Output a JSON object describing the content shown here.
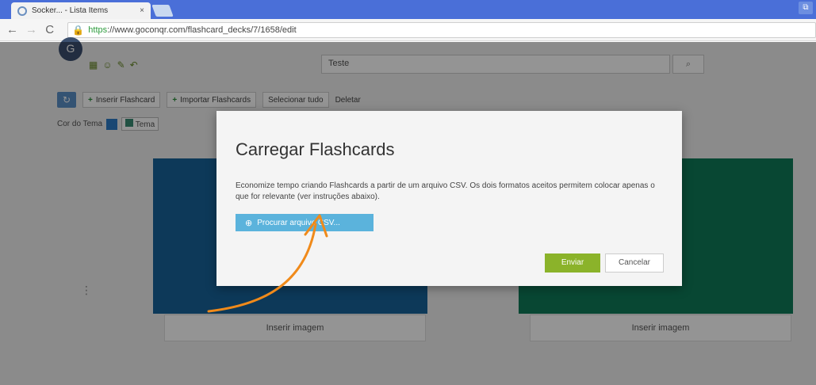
{
  "browser": {
    "tab_title": "Socker... - Lista Items",
    "tab_close": "×",
    "win_button": "⧉",
    "nav": {
      "back": "←",
      "forward": "→",
      "reload": "C"
    },
    "url_scheme": "https",
    "url_rest": "://www.goconqr.com/flashcard_decks/7/1658/edit"
  },
  "app": {
    "logo": "G",
    "toolbar_icons": [
      "▦",
      "☺",
      "✎",
      "↶"
    ],
    "deck_title": "Teste",
    "search_icon": "⌕",
    "actions": {
      "refresh": "↻",
      "insert_flashcard": "Inserir Flashcard",
      "import_flashcards": "Importar Flashcards",
      "select_all": "Selecionar tudo",
      "delete": "Deletar"
    },
    "theme": {
      "label": "Cor do Tema",
      "select_label": "Tema"
    },
    "card_footer_left": "Inserir imagem",
    "card_footer_right": "Inserir imagem",
    "side_handle": "⋮"
  },
  "modal": {
    "title": "Carregar Flashcards",
    "text": "Economize tempo criando Flashcards a partir de um arquivo CSV. Os dois formatos aceitos permitem colocar apenas o que for relevante (ver instruções abaixo).",
    "upload_label": "Procurar arquivo CSV...",
    "upload_icon": "⊕",
    "send_label": "Enviar",
    "cancel_label": "Cancelar"
  },
  "colors": {
    "tabstrip": "#4a6fd8",
    "card_blue": "#17639a",
    "card_green": "#0f7a58",
    "upload": "#5bb3dc",
    "send": "#8bb32a",
    "annotation_arrow": "#f08a1a"
  }
}
